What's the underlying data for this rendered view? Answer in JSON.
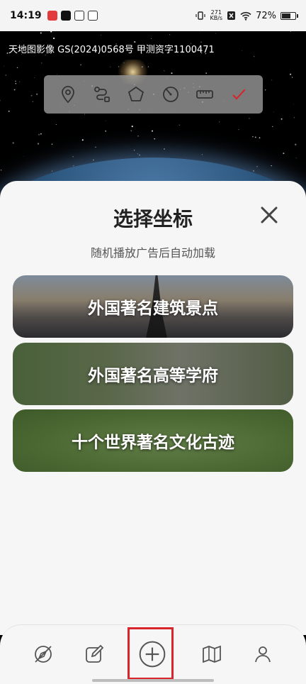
{
  "status_bar": {
    "time": "14:19",
    "net_speed_value": "271",
    "net_speed_unit": "KB/s",
    "battery": "72%",
    "battery_level": 0.72
  },
  "map": {
    "attribution": "天地图影像 GS(2024)0568号 甲测资字1100471"
  },
  "toolbar": {
    "tools": [
      "location-pin-icon",
      "route-icon",
      "polygon-icon",
      "circle-icon",
      "ruler-icon",
      "check-icon"
    ],
    "check_color": "#d8242a"
  },
  "sheet": {
    "title": "选择坐标",
    "subtitle": "随机播放广告后自动加载",
    "cards": [
      {
        "label": "外国著名建筑景点"
      },
      {
        "label": "外国著名高等学府"
      },
      {
        "label": "十个世界著名文化古迹"
      }
    ]
  },
  "nav": {
    "items": [
      "compass-off-icon",
      "edit-icon",
      "add-circle-icon",
      "map-icon",
      "user-icon"
    ],
    "highlight_color": "#d8242a"
  }
}
